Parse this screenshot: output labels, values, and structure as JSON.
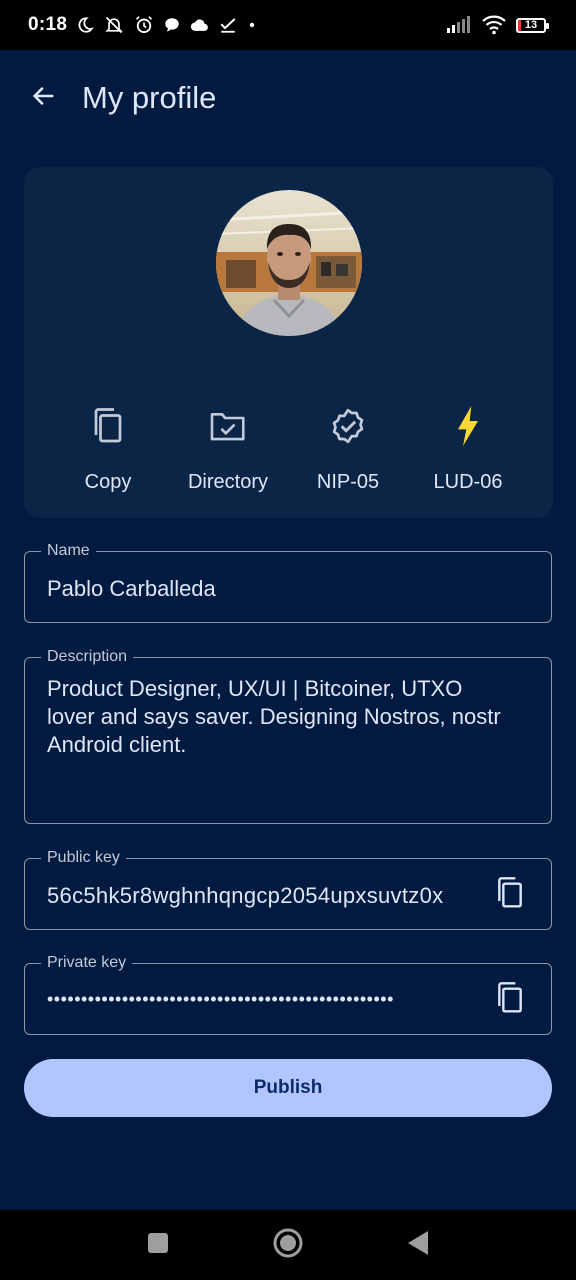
{
  "status_bar": {
    "time": "0:18",
    "battery_level": "13",
    "icons": [
      "moon-icon",
      "muted-bell-icon",
      "alarm-icon",
      "chat-bubble-icon",
      "cloud-icon",
      "check-icon",
      "dot-icon",
      "signal-icon",
      "wifi-icon",
      "battery-icon"
    ]
  },
  "header": {
    "title": "My profile",
    "back_icon": "arrow-left-icon"
  },
  "profile": {
    "actions": [
      {
        "label": "Copy",
        "icon": "copy-icon"
      },
      {
        "label": "Directory",
        "icon": "folder-check-icon"
      },
      {
        "label": "NIP-05",
        "icon": "verified-badge-icon"
      },
      {
        "label": "LUD-06",
        "icon": "lightning-icon"
      }
    ]
  },
  "form": {
    "name": {
      "label": "Name",
      "value": "Pablo Carballeda"
    },
    "description": {
      "label": "Description",
      "value": "Product Designer, UX/UI | Bitcoiner, UTXO lover and says saver. Designing Nostros, nostr Android client."
    },
    "public_key": {
      "label": "Public key",
      "value": "56c5hk5r8wghnhqngcp2054upxsuvtz0x"
    },
    "private_key": {
      "label": "Private key",
      "value": "•••••••••••••••••••••••••••••••••••••••••••••••••••"
    }
  },
  "publish_label": "Publish",
  "colors": {
    "background": "#001a40",
    "card": "#0b2547",
    "primary_button": "#b2c5ff",
    "lightning": "#fdd835"
  }
}
